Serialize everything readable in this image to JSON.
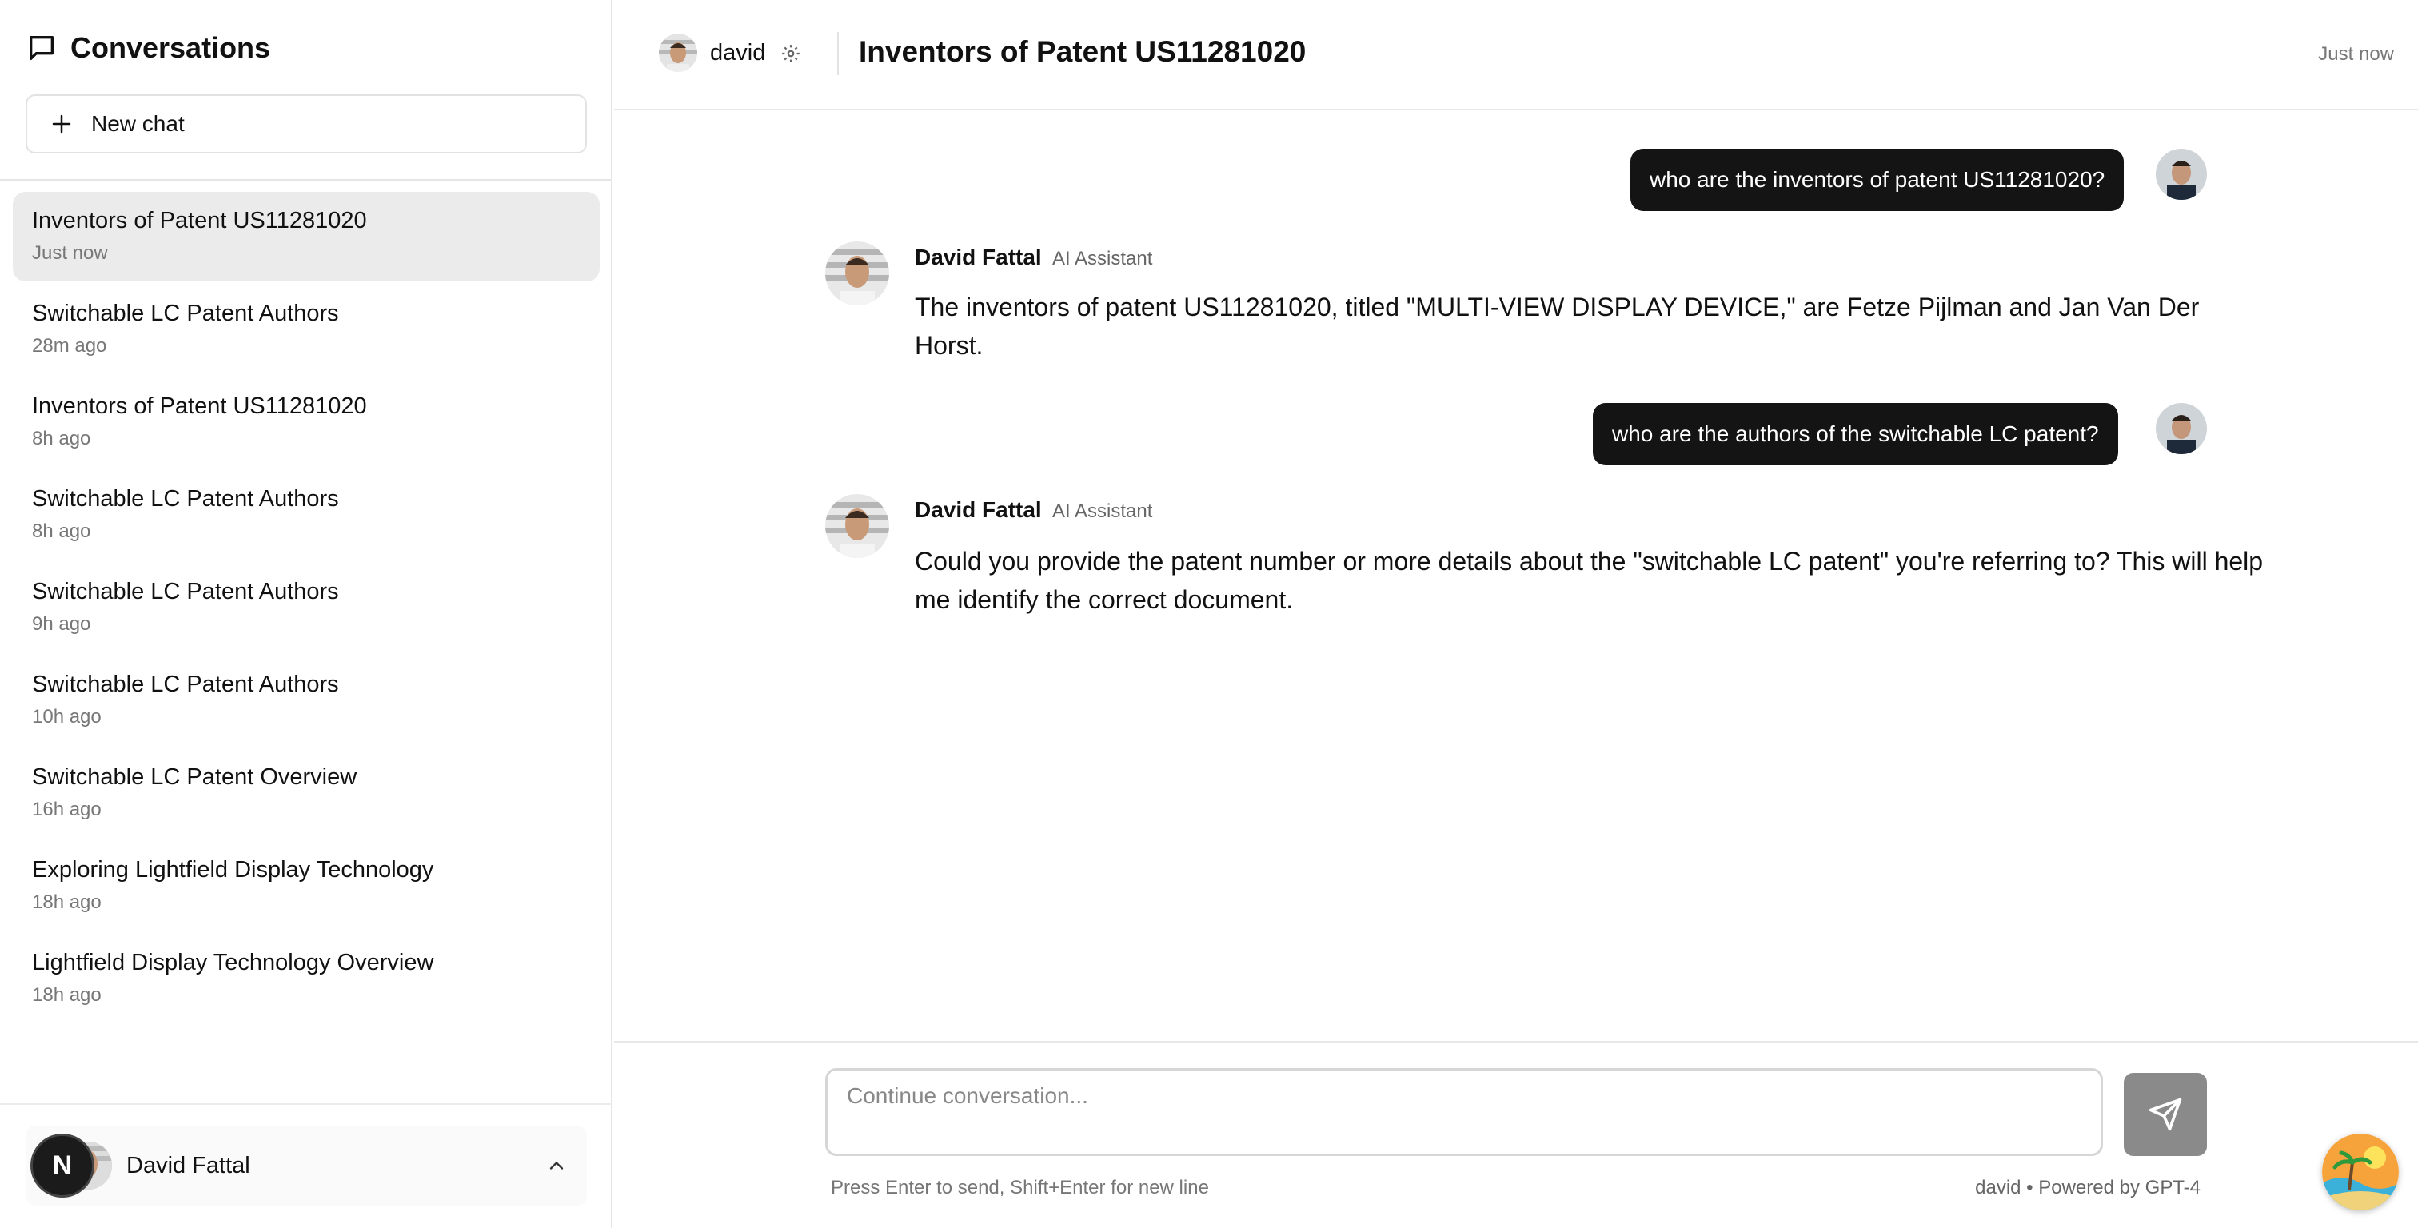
{
  "sidebar": {
    "title": "Conversations",
    "new_chat_label": "New chat",
    "conversations": [
      {
        "title": "Inventors of Patent US11281020",
        "time": "Just now",
        "active": true
      },
      {
        "title": "Switchable LC Patent Authors",
        "time": "28m ago"
      },
      {
        "title": "Inventors of Patent US11281020",
        "time": "8h ago"
      },
      {
        "title": "Switchable LC Patent Authors",
        "time": "8h ago"
      },
      {
        "title": "Switchable LC Patent Authors",
        "time": "9h ago"
      },
      {
        "title": "Switchable LC Patent Authors",
        "time": "10h ago"
      },
      {
        "title": "Switchable LC Patent Overview",
        "time": "16h ago"
      },
      {
        "title": "Exploring Lightfield Display Technology",
        "time": "18h ago"
      },
      {
        "title": "Lightfield Display Technology Overview",
        "time": "18h ago"
      }
    ],
    "user": {
      "badge": "N",
      "name": "David Fattal"
    }
  },
  "header": {
    "username": "david",
    "title": "Inventors of Patent US11281020",
    "time": "Just now"
  },
  "messages": [
    {
      "role": "user",
      "text": "who are the inventors of patent US11281020?"
    },
    {
      "role": "assistant",
      "name": "David Fattal",
      "role_label": "AI Assistant",
      "text": "The inventors of patent US11281020, titled \"MULTI-VIEW DISPLAY DEVICE,\" are Fetze Pijlman and Jan Van Der Horst."
    },
    {
      "role": "user",
      "text": "who are the authors of the switchable LC patent?"
    },
    {
      "role": "assistant",
      "name": "David Fattal",
      "role_label": "AI Assistant",
      "text": "Could you provide the patent number or more details about the \"switchable LC patent\" you're referring to? This will help me identify the correct document."
    }
  ],
  "composer": {
    "placeholder": "Continue conversation...",
    "value": "",
    "hint": "Press Enter to send, Shift+Enter for new line",
    "powered_by": "david • Powered by GPT-4"
  },
  "colors": {
    "active_item_bg": "#ebebeb",
    "user_bubble_bg": "#141414",
    "send_button_bg": "#8a8a8a"
  },
  "icons": [
    "chat-bubble-icon",
    "plus-icon",
    "gear-icon",
    "chevron-up-icon",
    "send-icon",
    "avatar"
  ]
}
